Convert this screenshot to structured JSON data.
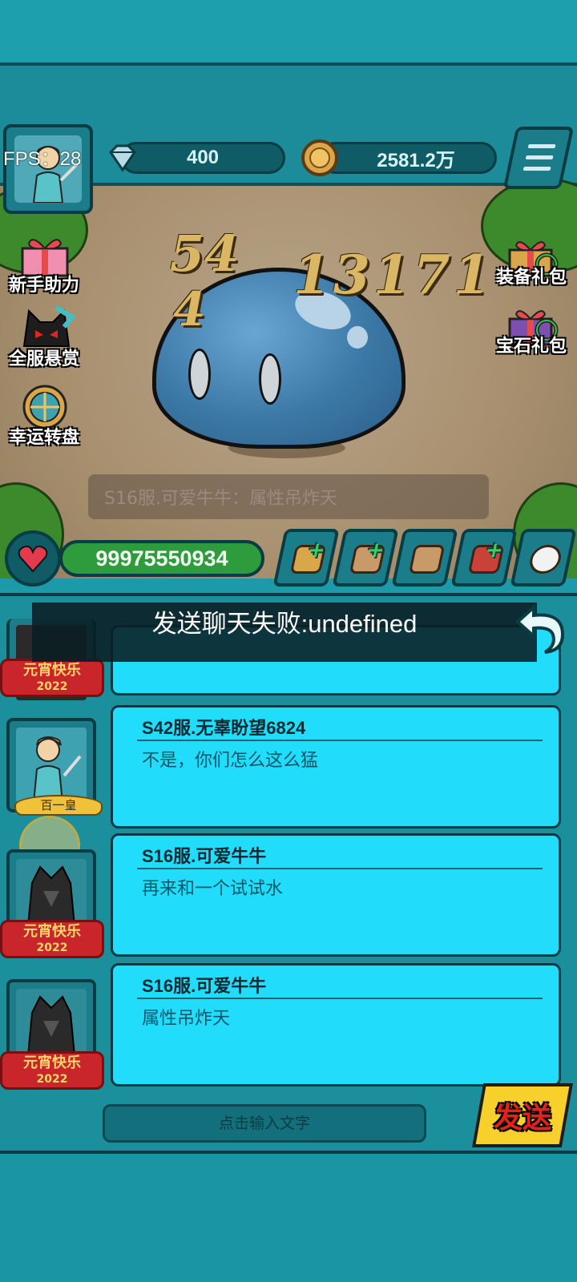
{
  "hud": {
    "fps_label": "FPS：28",
    "diamonds": "400",
    "gold": "2581.2万"
  },
  "side_left": [
    {
      "label": "新手助力",
      "icon": "gift-box-icon"
    },
    {
      "label": "全服悬赏",
      "icon": "bounty-cat-icon"
    },
    {
      "label": "幸运转盘",
      "icon": "lucky-wheel-icon"
    }
  ],
  "side_right": [
    {
      "label": "装备礼包",
      "icon": "equipment-gift-icon"
    },
    {
      "label": "宝石礼包",
      "icon": "gem-gift-icon"
    }
  ],
  "battle": {
    "damage_numbers": [
      "54",
      "4",
      "13171"
    ],
    "broadcast": "S16服.可爱牛牛：属性吊炸天"
  },
  "player": {
    "hp": "99975550934"
  },
  "actions": [
    {
      "icon": "upgrade-gold-icon"
    },
    {
      "icon": "upgrade-fist-icon"
    },
    {
      "icon": "fist-icon"
    },
    {
      "icon": "treasure-chest-icon"
    },
    {
      "icon": "chat-bubble-icon"
    }
  ],
  "chat": {
    "toast": "发送聊天失败:undefined",
    "messages": [
      {
        "name": "S42服.无辜盼望6824",
        "text": "不是，你们怎么这么猛",
        "badge": "百一皇"
      },
      {
        "name": "S16服.可爱牛牛",
        "text": "再来和一个试试水",
        "badge": "元宵快乐"
      },
      {
        "name": "S16服.可爱牛牛",
        "text": "属性吊炸天",
        "badge": "元宵快乐"
      }
    ],
    "top_badge": "元宵快乐",
    "badge_year": "2022",
    "input_placeholder": "点击输入文字",
    "send_label": "发送"
  },
  "colors": {
    "teal": "#1d9aa8",
    "bubble": "#22dcfb",
    "hp_green": "#2e9b3d",
    "send_yellow": "#f7d02b",
    "send_red": "#e3231b"
  }
}
